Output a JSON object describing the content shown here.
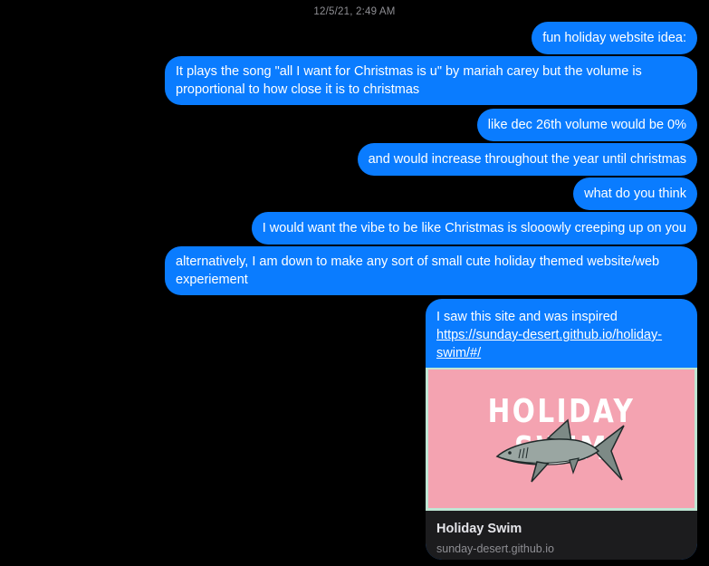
{
  "conversation": {
    "timestamp": "12/5/21, 2:49 AM",
    "messages": [
      "fun holiday website idea:",
      "It plays the song \"all I want for Christmas is u\" by mariah carey but the volume is proportional to how close it is to christmas",
      "like dec 26th volume would be 0%",
      "and would increase throughout the year until christmas",
      "what do you think",
      "I would want the vibe to be like Christmas is slooowly creeping up on you",
      "alternatively, I am down to make any sort of small cute holiday themed website/web experiement"
    ],
    "link_message": {
      "text": "I saw this site and was inspired",
      "url": "https://sunday-desert.github.io/holiday-swim/#/"
    },
    "link_preview": {
      "image_text": "HOLIDAY SWIM",
      "image_icon": "shark-icon",
      "title": "Holiday Swim",
      "domain": "sunday-desert.github.io"
    }
  },
  "colors": {
    "background": "#000000",
    "bubble": "#0a7cff",
    "preview_image_bg": "#f4a3b1",
    "preview_card_bg": "#1c1c1e"
  }
}
